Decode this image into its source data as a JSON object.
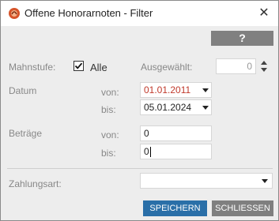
{
  "window": {
    "title": "Offene Honorarnoten - Filter",
    "icon": "app-logo-icon",
    "close_glyph": "✕"
  },
  "help_button": {
    "label": "?"
  },
  "mahnstufe": {
    "label": "Mahnstufe:",
    "checkbox_checked": true,
    "checkbox_label": "Alle",
    "selected_label": "Ausgewählt:",
    "selected_value": "0"
  },
  "datum": {
    "label": "Datum",
    "von_label": "von:",
    "von_value": "01.01.2011",
    "von_color": "#c0392b",
    "bis_label": "bis:",
    "bis_value": "05.01.2024"
  },
  "betraege": {
    "label": "Beträge",
    "von_label": "von:",
    "von_value": "0",
    "bis_label": "bis:",
    "bis_value": "0"
  },
  "zahlungsart": {
    "label": "Zahlungsart:",
    "value": ""
  },
  "buttons": {
    "save_label": "SPEICHERN",
    "close_label": "SCHLIESSEN",
    "save_color": "#2a6fa8",
    "close_color": "#7f7f7f"
  }
}
